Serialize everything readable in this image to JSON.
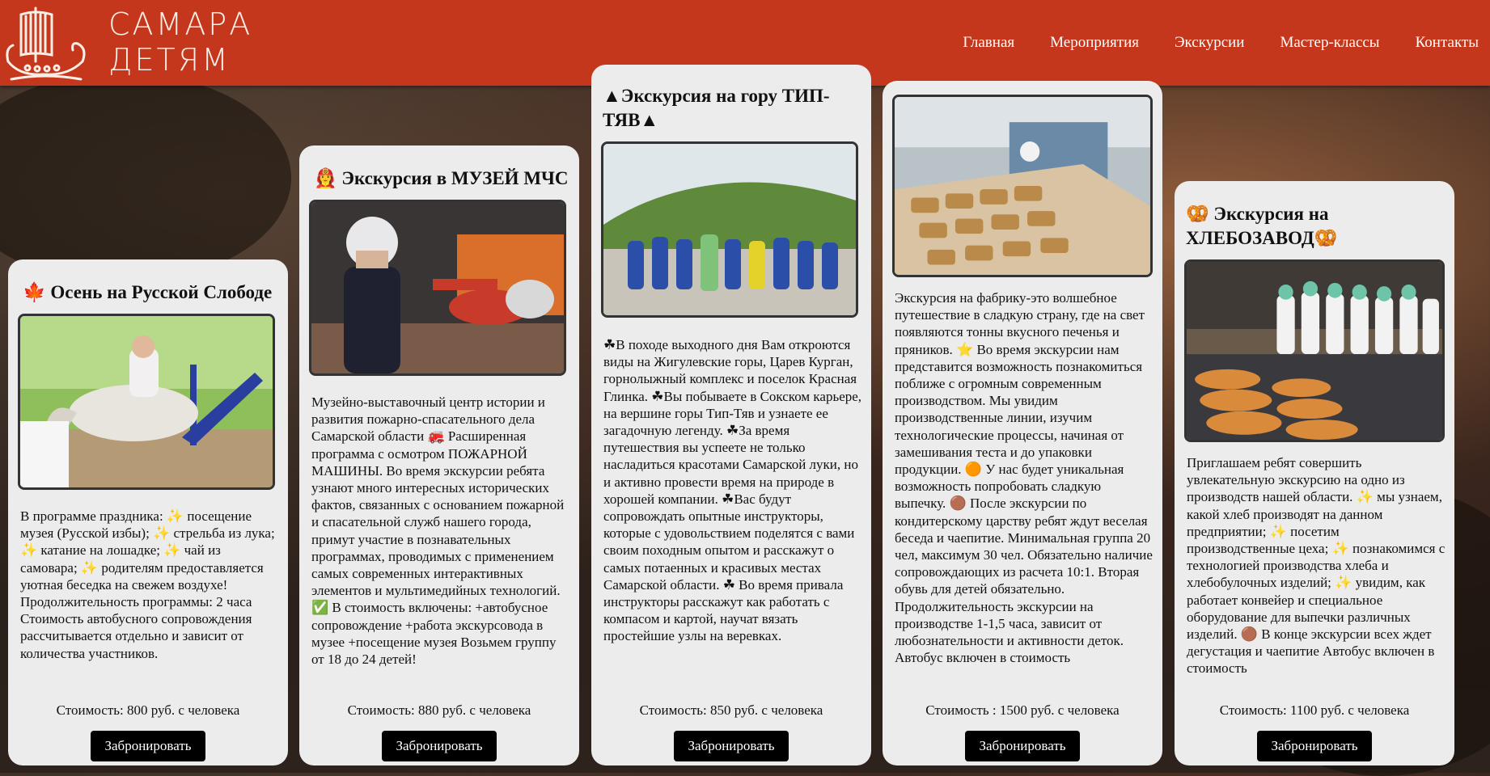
{
  "header": {
    "logo_line1": "САМАРА",
    "logo_line2": "ДЕТЯМ",
    "nav": [
      "Главная",
      "Мероприятия",
      "Экскурсии",
      "Мастер-классы",
      "Контакты"
    ]
  },
  "colors": {
    "header_bg": "#c4371c",
    "card_bg": "#ececec",
    "button_bg": "#000000"
  },
  "cards": [
    {
      "title": "🍁 Осень на Русской Слободе",
      "description": "В программе праздника: ✨ посещение музея (Русской избы); ✨ стрельба из лука; ✨ катание на лошадке; ✨ чай из самовара; ✨ родителям предоставляется уютная беседка на свежем воздухе! Продолжительность программы: 2 часа Стоимость автобусного сопровождения рассчитывается отдельно и зависит от количества участников.",
      "price": "Стоимость: 800 руб. с человека",
      "button": "Забронировать"
    },
    {
      "title": "👩‍🚒 Экскурсия в МУЗЕЙ МЧС",
      "description": "Музейно-выставочный центр истории и развития пожарно-спасательного дела Самарской области 🚒 Расширенная программа с осмотром ПОЖАРНОЙ МАШИНЫ. Во время экскурсии ребята узнают много интересных исторических фактов, связанных с основанием пожарной и спасательной служб нашего города, примут участие в познавательных программах, проводимых с применением самых современных интерактивных элементов и мультимедийных технологий. ✅ В стоимость включены: +автобусное сопровождение +работа экскурсовода в музее +посещение музея Возьмем группу от 18 до 24 детей!",
      "price": "Стоимость: 880 руб. с человека",
      "button": "Забронировать"
    },
    {
      "title": "▲Экскурсия на гору ТИП-ТЯВ▲",
      "description": "☘В походе выходного дня Вам откроются виды на Жигулевские горы, Царев Курган, горнолыжный комплекс и поселок Красная Глинка. ☘Вы побываете в Сокском карьере, на вершине горы Тип-Тяв и узнаете ее загадочную легенду. ☘За время путешествия вы успеете не только насладиться красотами Самарской луки, но и активно провести время на природе в хорошей компании. ☘Вас будут сопровождать опытные инструкторы, которые с удовольствием поделятся с вами своим походным опытом и расскажут о самых потаенных и красивых местах Самарской области. ☘ Во время привала инструкторы расскажут как работать с компасом и картой, научат вязать простейшие узлы на веревках.",
      "price": "Стоимость: 850 руб. с человека",
      "button": "Забронировать"
    },
    {
      "title": "",
      "description": "Экскурсия на фабрику-это волшебное путешествие в сладкую страну, где на свет появляются тонны вкусного печенья и пряников. ⭐ Во время экскурсии нам представится возможность познакомиться поближе с огромным современным производством. Мы увидим производственные линии, изучим технологические процессы, начиная от замешивания теста и до упаковки продукции. 🟠 У нас будет уникальная возможность попробовать сладкую выпечку. 🟤 После экскурсии по кондитерскому царству ребят ждут веселая беседа и чаепитие. Минимальная группа 20 чел, максимум 30 чел. Обязательно наличие сопровождающих из расчета 10:1. Вторая обувь для детей обязательно. Продолжительность экскурсии на производстве 1-1,5 часа, зависит от любознательности и активности деток. Автобус включен в стоимость",
      "price": "Стоимость : 1500 руб. с человека",
      "button": "Забронировать"
    },
    {
      "title": "🥨 Экскурсия на ХЛЕБОЗАВОД🥨",
      "description": "Приглашаем ребят совершить увлекательную экскурсию на одно из производств нашей области. ✨ мы узнаем, какой хлеб производят на данном предприятии; ✨ посетим производственные цеха; ✨ познакомимся с технологией производства хлеба и хлебобулочных изделий; ✨ увидим, как работает конвейер и специальное оборудование для выпечки различных изделий. 🟤 В конце экскурсии всех ждет дегустация и чаепитие Автобус включен в стоимость",
      "price": "Стоимость: 1100 руб. с человека",
      "button": "Забронировать"
    }
  ]
}
